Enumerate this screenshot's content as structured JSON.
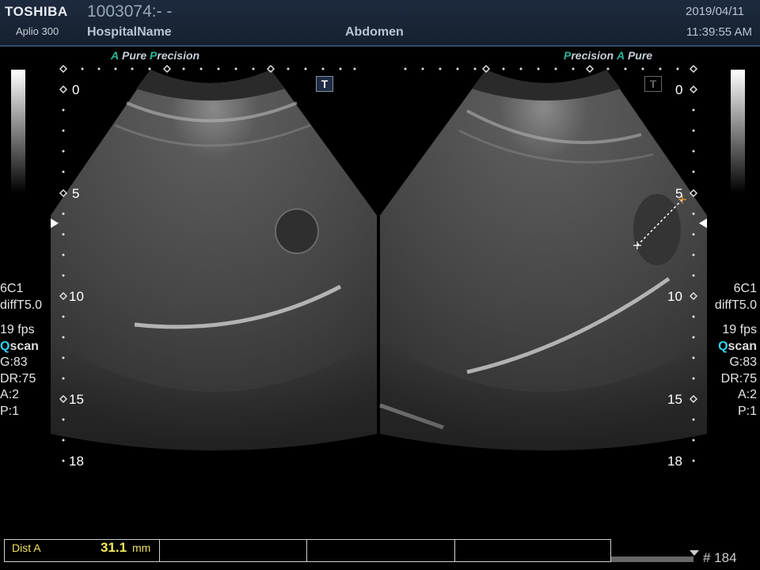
{
  "header": {
    "brand": "TOSHIBA",
    "model": "Aplio 300",
    "patient_id": "1003074:- -",
    "hospital": "HospitalName",
    "exam": "Abdomen",
    "date": "2019/04/11",
    "time": "11:39:55 AM"
  },
  "left_panel": {
    "tag_a": "A",
    "tag_pure": "Pure",
    "tag_p": "P",
    "tag_precision": "recision",
    "depth_marks": [
      "0",
      "5",
      "10",
      "15",
      "18"
    ],
    "t_label": "T"
  },
  "right_panel": {
    "tag_p": "P",
    "tag_precision": "recision",
    "tag_a": "A",
    "tag_pure": "Pure",
    "depth_marks": [
      "0",
      "5",
      "10",
      "15",
      "18"
    ],
    "t_label": "T"
  },
  "params": {
    "probe": "6C1",
    "mode": "diffT5.0",
    "fps": "19 fps",
    "q": "Q",
    "scan": "scan",
    "gain": "G:83",
    "dr": "DR:75",
    "a": "A:2",
    "p": "P:1"
  },
  "measurement": {
    "label": "Dist A",
    "value": "31.1",
    "unit": "mm"
  },
  "footer": {
    "frame": "# 184"
  }
}
